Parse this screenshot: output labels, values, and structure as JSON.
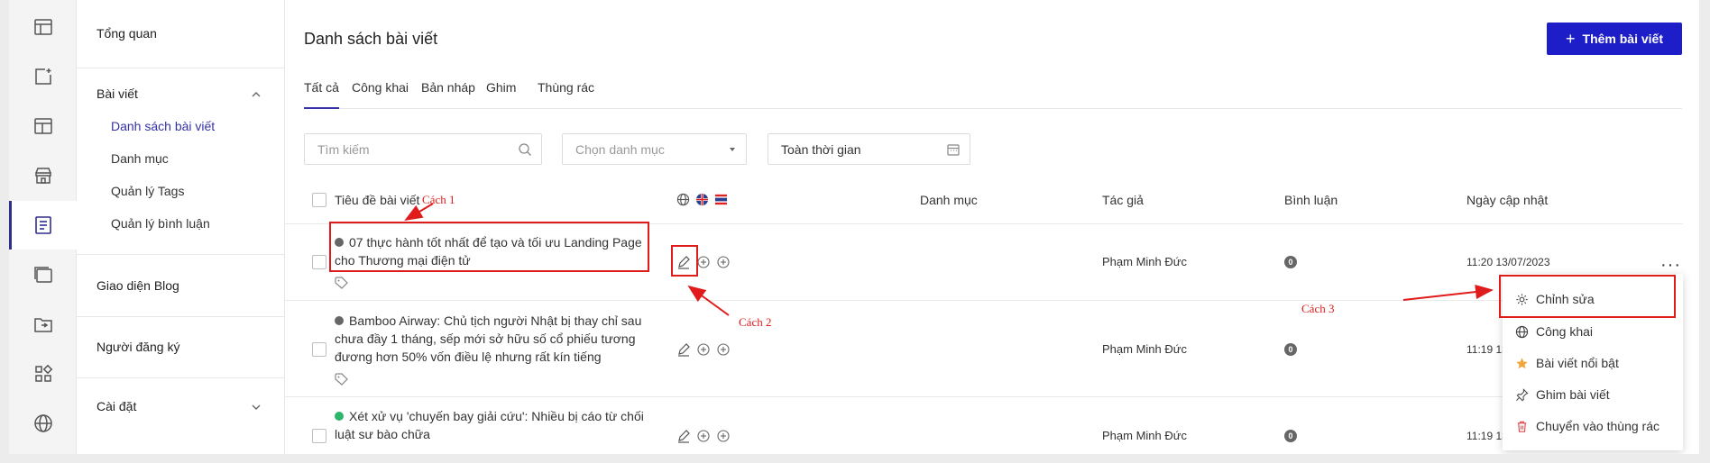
{
  "nav": {
    "overview": "Tổng quan",
    "posts_section": "Bài viết",
    "posts_sub": [
      "Danh sách bài viết",
      "Danh mục",
      "Quản lý Tags",
      "Quản lý bình luận"
    ],
    "blog_ui": "Giao diện Blog",
    "subscribers": "Người đăng ký",
    "settings": "Cài đặt"
  },
  "header": {
    "title": "Danh sách bài viết",
    "add_button": "Thêm bài viết"
  },
  "tabs": [
    "Tất cả",
    "Công khai",
    "Bản nháp",
    "Ghim",
    "Thùng rác"
  ],
  "filters": {
    "search_placeholder": "Tìm kiếm",
    "category_placeholder": "Chọn danh mục",
    "time_value": "Toàn thời gian"
  },
  "table": {
    "columns": [
      "Tiêu đề bài viết",
      "Danh mục",
      "Tác giả",
      "Bình luận",
      "Ngày cập nhật"
    ],
    "rows": [
      {
        "title": "07 thực hành tốt nhất để tạo và tối ưu Landing Page cho Thương mại điện tử",
        "status_color": "#666666",
        "author": "Phạm Minh Đức",
        "comments": "0",
        "updated": "11:20 13/07/2023"
      },
      {
        "title": "Bamboo Airway: Chủ tịch người Nhật bị thay chỉ sau chưa đầy 1 tháng, sếp mới sở hữu số cổ phiếu tương đương hơn 50% vốn điều lệ nhưng rất kín tiếng",
        "status_color": "#666666",
        "author": "Phạm Minh Đức",
        "comments": "0",
        "updated": "11:19 13"
      },
      {
        "title": "Xét xử vụ 'chuyến bay giải cứu': Nhiều bị cáo từ chối luật sư bào chữa",
        "status_color": "#2db56b",
        "author": "Phạm Minh Đức",
        "comments": "0",
        "updated": "11:19 13"
      }
    ]
  },
  "menu": [
    "Chỉnh sửa",
    "Công khai",
    "Bài viết nổi bật",
    "Ghim bài viết",
    "Chuyển vào thùng rác"
  ],
  "annotations": [
    "Cách 1",
    "Cách 2",
    "Cách 3"
  ],
  "colors": {
    "accent": "#1e1ec8",
    "active_nav": "#3531a8",
    "annotation": "#e01b1b",
    "star": "#f0a63a",
    "trash": "#e0464a"
  }
}
